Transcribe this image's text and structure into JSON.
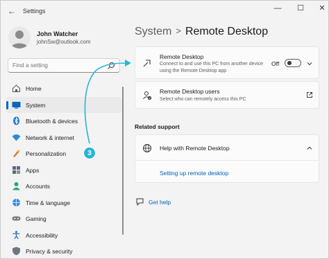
{
  "window": {
    "title": "Settings"
  },
  "controls": {
    "minimize": "—",
    "maximize": "☐",
    "close": "✕",
    "back": "←"
  },
  "profile": {
    "name": "John Watcher",
    "email": "johnSw@outlook.com"
  },
  "search": {
    "placeholder": "Find a setting"
  },
  "nav": {
    "items": [
      {
        "label": "Home",
        "icon": "home-icon"
      },
      {
        "label": "System",
        "icon": "system-icon",
        "selected": true
      },
      {
        "label": "Bluetooth & devices",
        "icon": "bluetooth-icon"
      },
      {
        "label": "Network & internet",
        "icon": "wifi-icon"
      },
      {
        "label": "Personalization",
        "icon": "brush-icon"
      },
      {
        "label": "Apps",
        "icon": "apps-icon"
      },
      {
        "label": "Accounts",
        "icon": "accounts-icon"
      },
      {
        "label": "Time & language",
        "icon": "globe-clock-icon"
      },
      {
        "label": "Gaming",
        "icon": "gamepad-icon"
      },
      {
        "label": "Accessibility",
        "icon": "accessibility-icon"
      },
      {
        "label": "Privacy & security",
        "icon": "shield-icon"
      }
    ]
  },
  "header": {
    "parent": "System",
    "separator": ">",
    "title": "Remote Desktop"
  },
  "remote_desktop": {
    "title": "Remote Desktop",
    "description": "Connect to and use this PC from another device using the Remote Desktop app",
    "state_label": "Off",
    "enabled": false
  },
  "remote_users": {
    "title": "Remote Desktop users",
    "description": "Select who can remotely access this PC"
  },
  "related": {
    "heading": "Related support",
    "help_title": "Help with Remote Desktop",
    "link": "Setting up remote desktop"
  },
  "get_help": {
    "label": "Get help"
  },
  "annotation": {
    "step": "3",
    "color": "#29b6d6"
  },
  "colors": {
    "accent": "#0067c0",
    "link": "#005fb8",
    "annotation": "#29b6d6"
  }
}
